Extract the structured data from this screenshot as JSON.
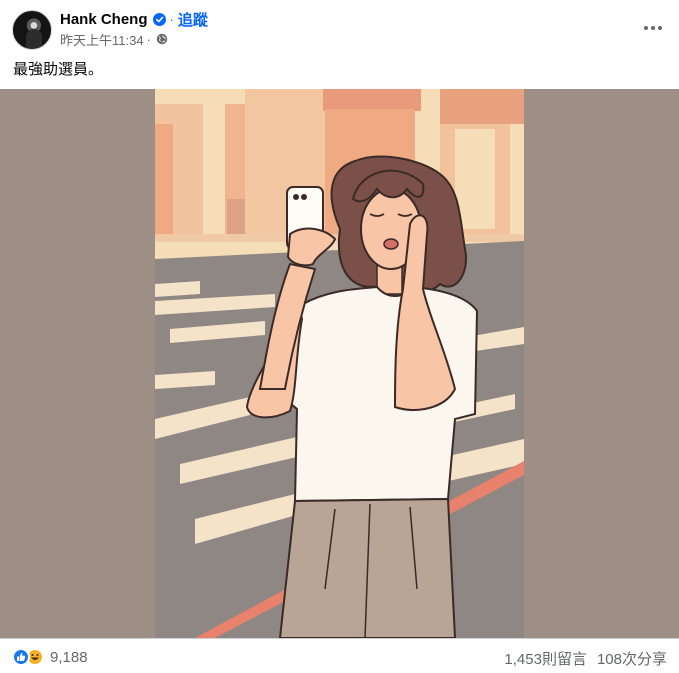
{
  "post": {
    "author": "Hank Cheng",
    "separator": "·",
    "follow_label": "追蹤",
    "timestamp": "昨天上午11:34",
    "meta_separator": "·",
    "audience_icon": "globe-icon",
    "caption": "最強助選員。"
  },
  "image": {
    "description_icon": "illustration-woman-with-phone",
    "colors": {
      "backdrop": "#9d8f85",
      "sky": "#f5ddb8",
      "buildings": "#efa983",
      "road": "#8f8783",
      "shirt": "#fbf6ee",
      "pants": "#b8a596",
      "skin": "#f8c5a7",
      "hair": "#7a5049"
    }
  },
  "footer": {
    "reaction_icons": [
      "like-icon",
      "haha-icon"
    ],
    "reaction_count": "9,188",
    "comments": "1,453則留言",
    "shares": "108次分享"
  },
  "colors": {
    "accent": "#0866ff",
    "secondary_text": "#65676b",
    "divider": "#ced0d4"
  }
}
